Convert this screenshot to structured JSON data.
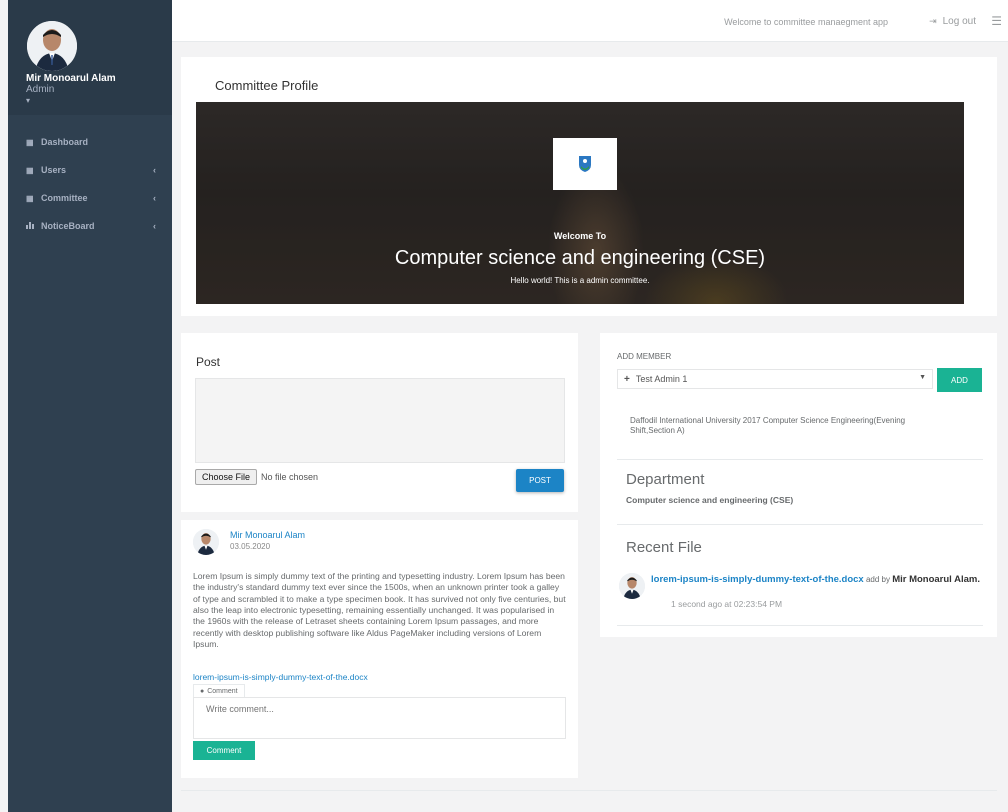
{
  "sidebar": {
    "user_name": "Mir Monoarul Alam",
    "user_role": "Admin",
    "caret": "▾",
    "items": [
      {
        "label": "Dashboard",
        "icon": "grid-icon",
        "has_chevron": false
      },
      {
        "label": "Users",
        "icon": "grid-icon",
        "has_chevron": true
      },
      {
        "label": "Committee",
        "icon": "grid-icon",
        "has_chevron": true
      },
      {
        "label": "NoticeBoard",
        "icon": "bar-chart-icon",
        "has_chevron": true
      }
    ]
  },
  "topbar": {
    "welcome_text": "Welcome to committee manaegment app",
    "logout_label": "Log out"
  },
  "profile_card": {
    "title": "Committee Profile",
    "banner_welcome": "Welcome To",
    "banner_title": "Computer science and engineering (CSE)",
    "banner_subtitle": "Hello world! This is a admin committee."
  },
  "post": {
    "title": "Post",
    "choose_file_label": "Choose File",
    "no_file_text": "No file chosen",
    "post_button": "POST"
  },
  "feed": {
    "author": "Mir Monoarul Alam",
    "date": "03.05.2020",
    "body": "Lorem Ipsum is simply dummy text of the printing and typesetting industry. Lorem Ipsum has been the industry's standard dummy text ever since the 1500s, when an unknown printer took a galley of type and scrambled it to make a type specimen book. It has survived not only five centuries, but also the leap into electronic typesetting, remaining essentially unchanged. It was popularised in the 1960s with the release of Letraset sheets containing Lorem Ipsum passages, and more recently with desktop publishing software like Aldus PageMaker including versions of Lorem Ipsum.",
    "attachment": "lorem-ipsum-is-simply-dummy-text-of-the.docx",
    "comment_tab": "Comment",
    "comment_placeholder": "Write comment...",
    "comment_button": "Comment"
  },
  "right": {
    "add_member_label": "ADD MEMBER",
    "selected_member": "Test Admin 1",
    "add_button": "ADD",
    "description": "Daffodil International University 2017 Computer Science Engineering(Evening Shift,Section A)",
    "department_heading": "Department",
    "department_value": "Computer science and engineering (CSE)",
    "recent_file_heading": "Recent File",
    "recent_file_name": "lorem-ipsum-is-simply-dummy-text-of-the.docx",
    "recent_file_add_by": " add by ",
    "recent_file_user": "Mir Monoarul Alam",
    "recent_file_time": "1 second ago at 02:23:54 PM"
  },
  "colors": {
    "sidebar_bg": "#2f4050",
    "primary_blue": "#1c84c6",
    "primary_green": "#1ab394"
  }
}
